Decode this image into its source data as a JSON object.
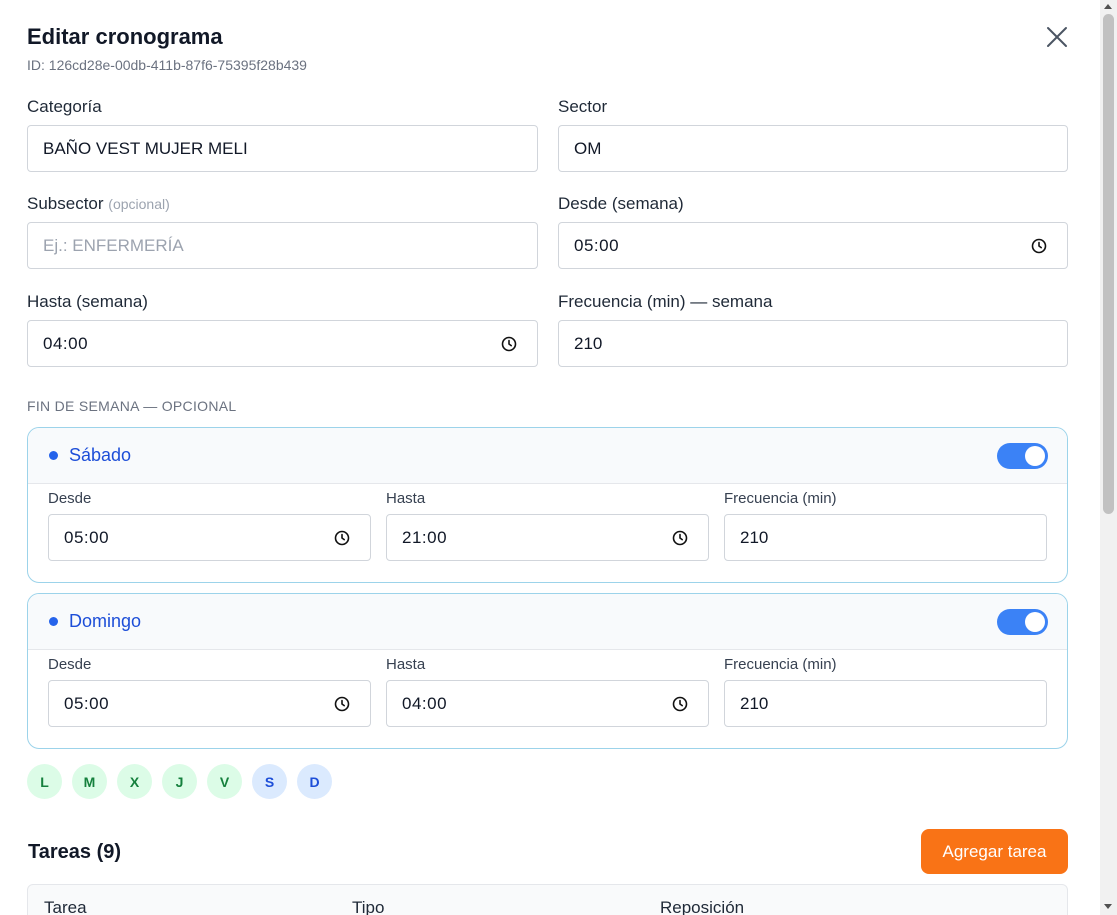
{
  "modal": {
    "title": "Editar cronograma",
    "id_text": "ID: 126cd28e-00db-411b-87f6-75395f28b439"
  },
  "fields": {
    "categoria": {
      "label": "Categoría",
      "value": "BAÑO VEST MUJER MELI"
    },
    "sector": {
      "label": "Sector",
      "value": "OM"
    },
    "subsector": {
      "label": "Subsector",
      "optional": "(opcional)",
      "placeholder": "Ej.: ENFERMERÍA"
    },
    "desde_semana": {
      "label": "Desde (semana)",
      "value": "05:00"
    },
    "hasta_semana": {
      "label": "Hasta (semana)",
      "value": "04:00"
    },
    "frecuencia_semana": {
      "label": "Frecuencia (min) — semana",
      "value": "210"
    }
  },
  "weekend": {
    "caption": "FIN DE SEMANA — OPCIONAL",
    "desde_label": "Desde",
    "hasta_label": "Hasta",
    "frecuencia_label": "Frecuencia (min)",
    "days": [
      {
        "name": "Sábado",
        "enabled": true,
        "desde": "05:00",
        "hasta": "21:00",
        "frecuencia": "210"
      },
      {
        "name": "Domingo",
        "enabled": true,
        "desde": "05:00",
        "hasta": "04:00",
        "frecuencia": "210"
      }
    ]
  },
  "day_chips": [
    "L",
    "M",
    "X",
    "J",
    "V",
    "S",
    "D"
  ],
  "colors": {
    "accent": "#3b82f6",
    "weekday_chip_bg": "#dcfce7",
    "weekday_chip_text": "#15803d",
    "weekend_chip_bg": "#dbeafe",
    "weekend_chip_text": "#1d4ed8",
    "add_button": "#f97316"
  },
  "tasks": {
    "title": "Tareas (9)",
    "add_label": "Agregar tarea",
    "columns": [
      "Tarea",
      "Tipo",
      "Reposición"
    ]
  }
}
